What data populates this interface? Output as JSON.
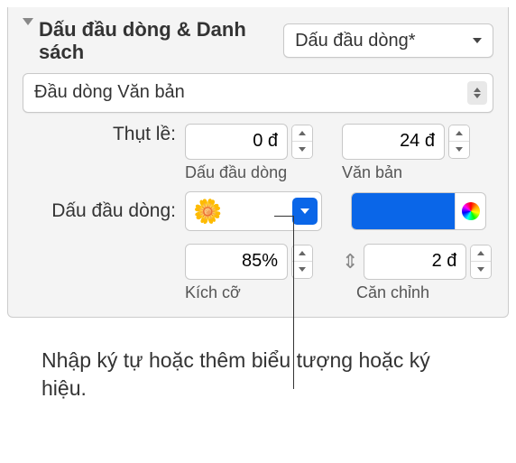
{
  "header": {
    "title": "Dấu đầu dòng & Danh sách",
    "style_popup": "Dấu đầu dòng*"
  },
  "bullet_type": "Đầu dòng Văn bản",
  "indent": {
    "label": "Thụt lề:",
    "bullet_value": "0 đ",
    "bullet_label": "Dấu đầu dòng",
    "text_value": "24 đ",
    "text_label": "Văn bản"
  },
  "bullet": {
    "label": "Dấu đầu dòng:",
    "glyph": "🌼",
    "color": "#0a66e8"
  },
  "size": {
    "value": "85%",
    "label": "Kích cỡ"
  },
  "align": {
    "value": "2 đ",
    "label": "Căn chỉnh"
  },
  "caption": "Nhập ký tự hoặc thêm biểu tượng hoặc ký hiệu."
}
